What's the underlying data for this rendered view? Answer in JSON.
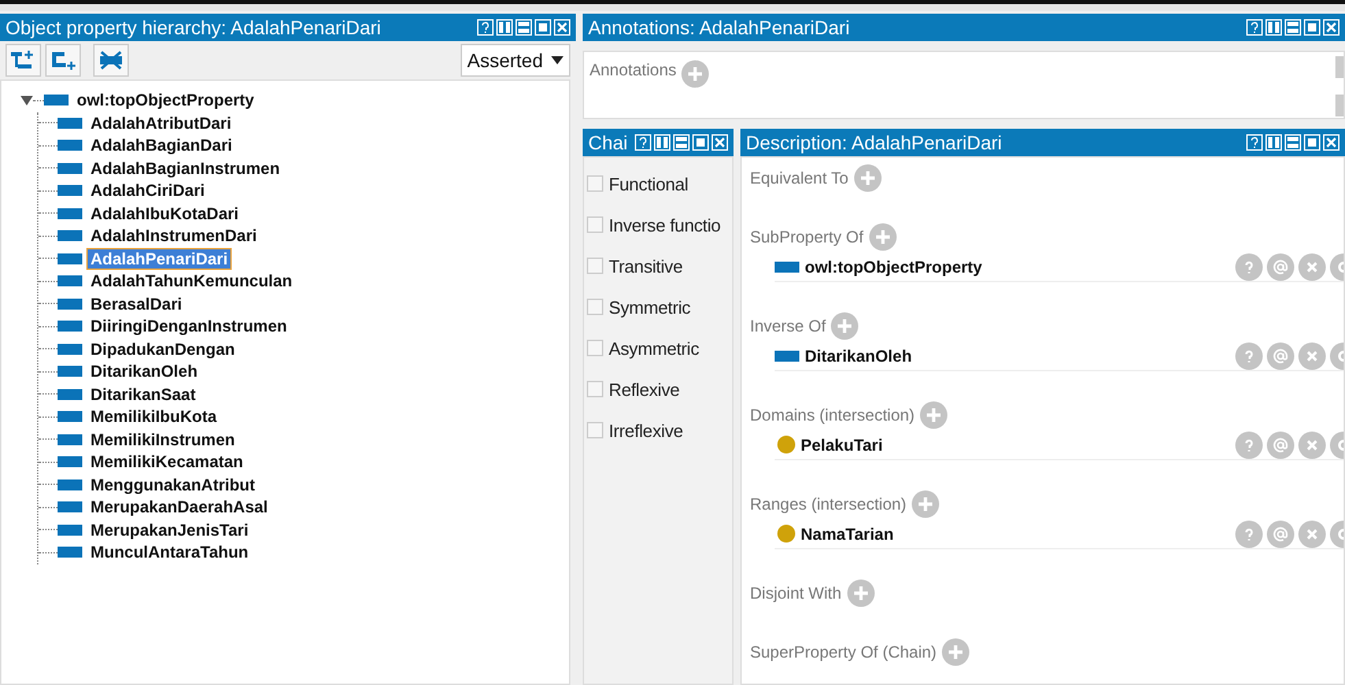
{
  "hierarchy": {
    "title": "Object property hierarchy: AdalahPenariDari",
    "view_select": "Asserted",
    "root": {
      "label": "owl:topObjectProperty",
      "expanded": true,
      "children": [
        {
          "label": "AdalahAtributDari",
          "selected": false
        },
        {
          "label": "AdalahBagianDari",
          "selected": false
        },
        {
          "label": "AdalahBagianInstrumen",
          "selected": false
        },
        {
          "label": "AdalahCiriDari",
          "selected": false
        },
        {
          "label": "AdalahIbuKotaDari",
          "selected": false
        },
        {
          "label": "AdalahInstrumenDari",
          "selected": false
        },
        {
          "label": "AdalahPenariDari",
          "selected": true
        },
        {
          "label": "AdalahTahunKemunculan",
          "selected": false
        },
        {
          "label": "BerasalDari",
          "selected": false
        },
        {
          "label": "DiiringiDenganInstrumen",
          "selected": false
        },
        {
          "label": "DipadukanDengan",
          "selected": false
        },
        {
          "label": "DitarikanOleh",
          "selected": false
        },
        {
          "label": "DitarikanSaat",
          "selected": false
        },
        {
          "label": "MemilikiIbuKota",
          "selected": false
        },
        {
          "label": "MemilikiInstrumen",
          "selected": false
        },
        {
          "label": "MemilikiKecamatan",
          "selected": false
        },
        {
          "label": "MenggunakanAtribut",
          "selected": false
        },
        {
          "label": "MerupakanDaerahAsal",
          "selected": false
        },
        {
          "label": "MerupakanJenisTari",
          "selected": false
        },
        {
          "label": "MunculAntaraTahun",
          "selected": false
        }
      ]
    }
  },
  "annotations": {
    "title": "Annotations: AdalahPenariDari",
    "label": "Annotations"
  },
  "characteristics": {
    "title": "Chai",
    "items": [
      {
        "label": "Functional",
        "checked": false
      },
      {
        "label": "Inverse functio",
        "checked": false
      },
      {
        "label": "Transitive",
        "checked": false
      },
      {
        "label": "Symmetric",
        "checked": false
      },
      {
        "label": "Asymmetric",
        "checked": false
      },
      {
        "label": "Reflexive",
        "checked": false
      },
      {
        "label": "Irreflexive",
        "checked": false
      }
    ]
  },
  "description": {
    "title": "Description: AdalahPenariDari",
    "sections": [
      {
        "label": "Equivalent To"
      },
      {
        "label": "SubProperty Of",
        "items": [
          {
            "label": "owl:topObjectProperty",
            "kind": "property"
          }
        ]
      },
      {
        "label": "Inverse Of",
        "items": [
          {
            "label": "DitarikanOleh",
            "kind": "property"
          }
        ]
      },
      {
        "label": "Domains (intersection)",
        "items": [
          {
            "label": "PelakuTari",
            "kind": "class"
          }
        ]
      },
      {
        "label": "Ranges (intersection)",
        "items": [
          {
            "label": "NamaTarian",
            "kind": "class"
          }
        ]
      },
      {
        "label": "Disjoint With"
      },
      {
        "label": "SuperProperty Of (Chain)"
      }
    ]
  }
}
